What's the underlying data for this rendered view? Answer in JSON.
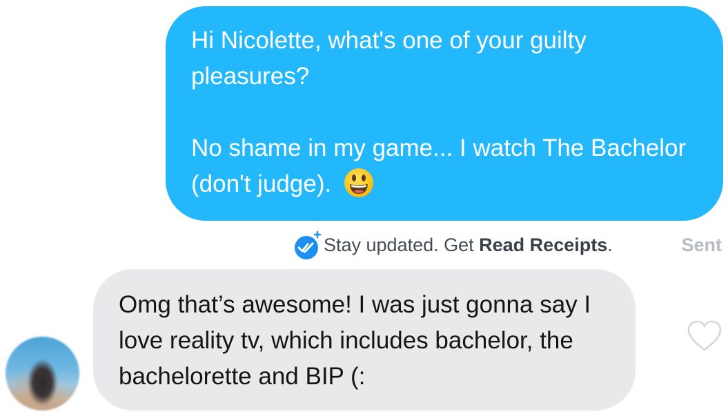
{
  "sent_message": {
    "paragraph1": "Hi Nicolette, what's one of your guilty pleasures?",
    "paragraph2": "No shame in my game... I watch The Bachelor (don't judge).",
    "emoji": "smiley-face-emoji",
    "bubble_color": "#23b8fc"
  },
  "status": {
    "receipt_prefix": "Stay updated. Get ",
    "receipt_link": "Read Receipts",
    "receipt_suffix": ".",
    "sent_label": "Sent",
    "icon": "read-receipt-checkmark-icon"
  },
  "received_message": {
    "text": "Omg that’s awesome! I was just gonna say I love reality tv, which includes bachelor, the bachelorette and BIP (:",
    "bubble_color": "#e9e9eb",
    "like_icon": "heart-outline-icon"
  }
}
